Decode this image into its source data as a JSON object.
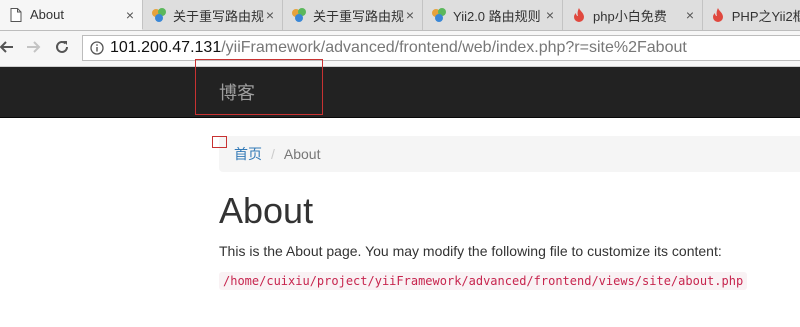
{
  "browser": {
    "tabs": [
      {
        "title": "About",
        "favicon": "document-icon",
        "active": true
      },
      {
        "title": "关于重写路由规",
        "favicon": "yii-logo-icon",
        "active": false
      },
      {
        "title": "关于重写路由规",
        "favicon": "yii-logo-icon",
        "active": false
      },
      {
        "title": "Yii2.0 路由规则",
        "favicon": "yii-logo-icon",
        "active": false
      },
      {
        "title": "php小白免费",
        "favicon": "flame-icon",
        "active": false
      },
      {
        "title": "PHP之Yii2框",
        "favicon": "flame-icon",
        "active": false
      }
    ],
    "close_glyph": "×",
    "address": {
      "host": "101.200.47.131",
      "path": "/yiiFramework/advanced/frontend/web/index.php?r=site%2Fabout"
    }
  },
  "site": {
    "brand": "博客",
    "breadcrumb": {
      "home": "首页",
      "separator": "/",
      "active": "About"
    },
    "title": "About",
    "description": "This is the About page. You may modify the following file to customize its content:",
    "code_path": "/home/cuixiu/project/yiiFramework/advanced/frontend/views/site/about.php"
  },
  "colors": {
    "navbar_bg": "#222222",
    "brand_text": "#9d9d9d",
    "link": "#337ab7",
    "code_text": "#c7254e",
    "code_bg": "#f9f2f4",
    "annotation_box": "#c83232"
  }
}
